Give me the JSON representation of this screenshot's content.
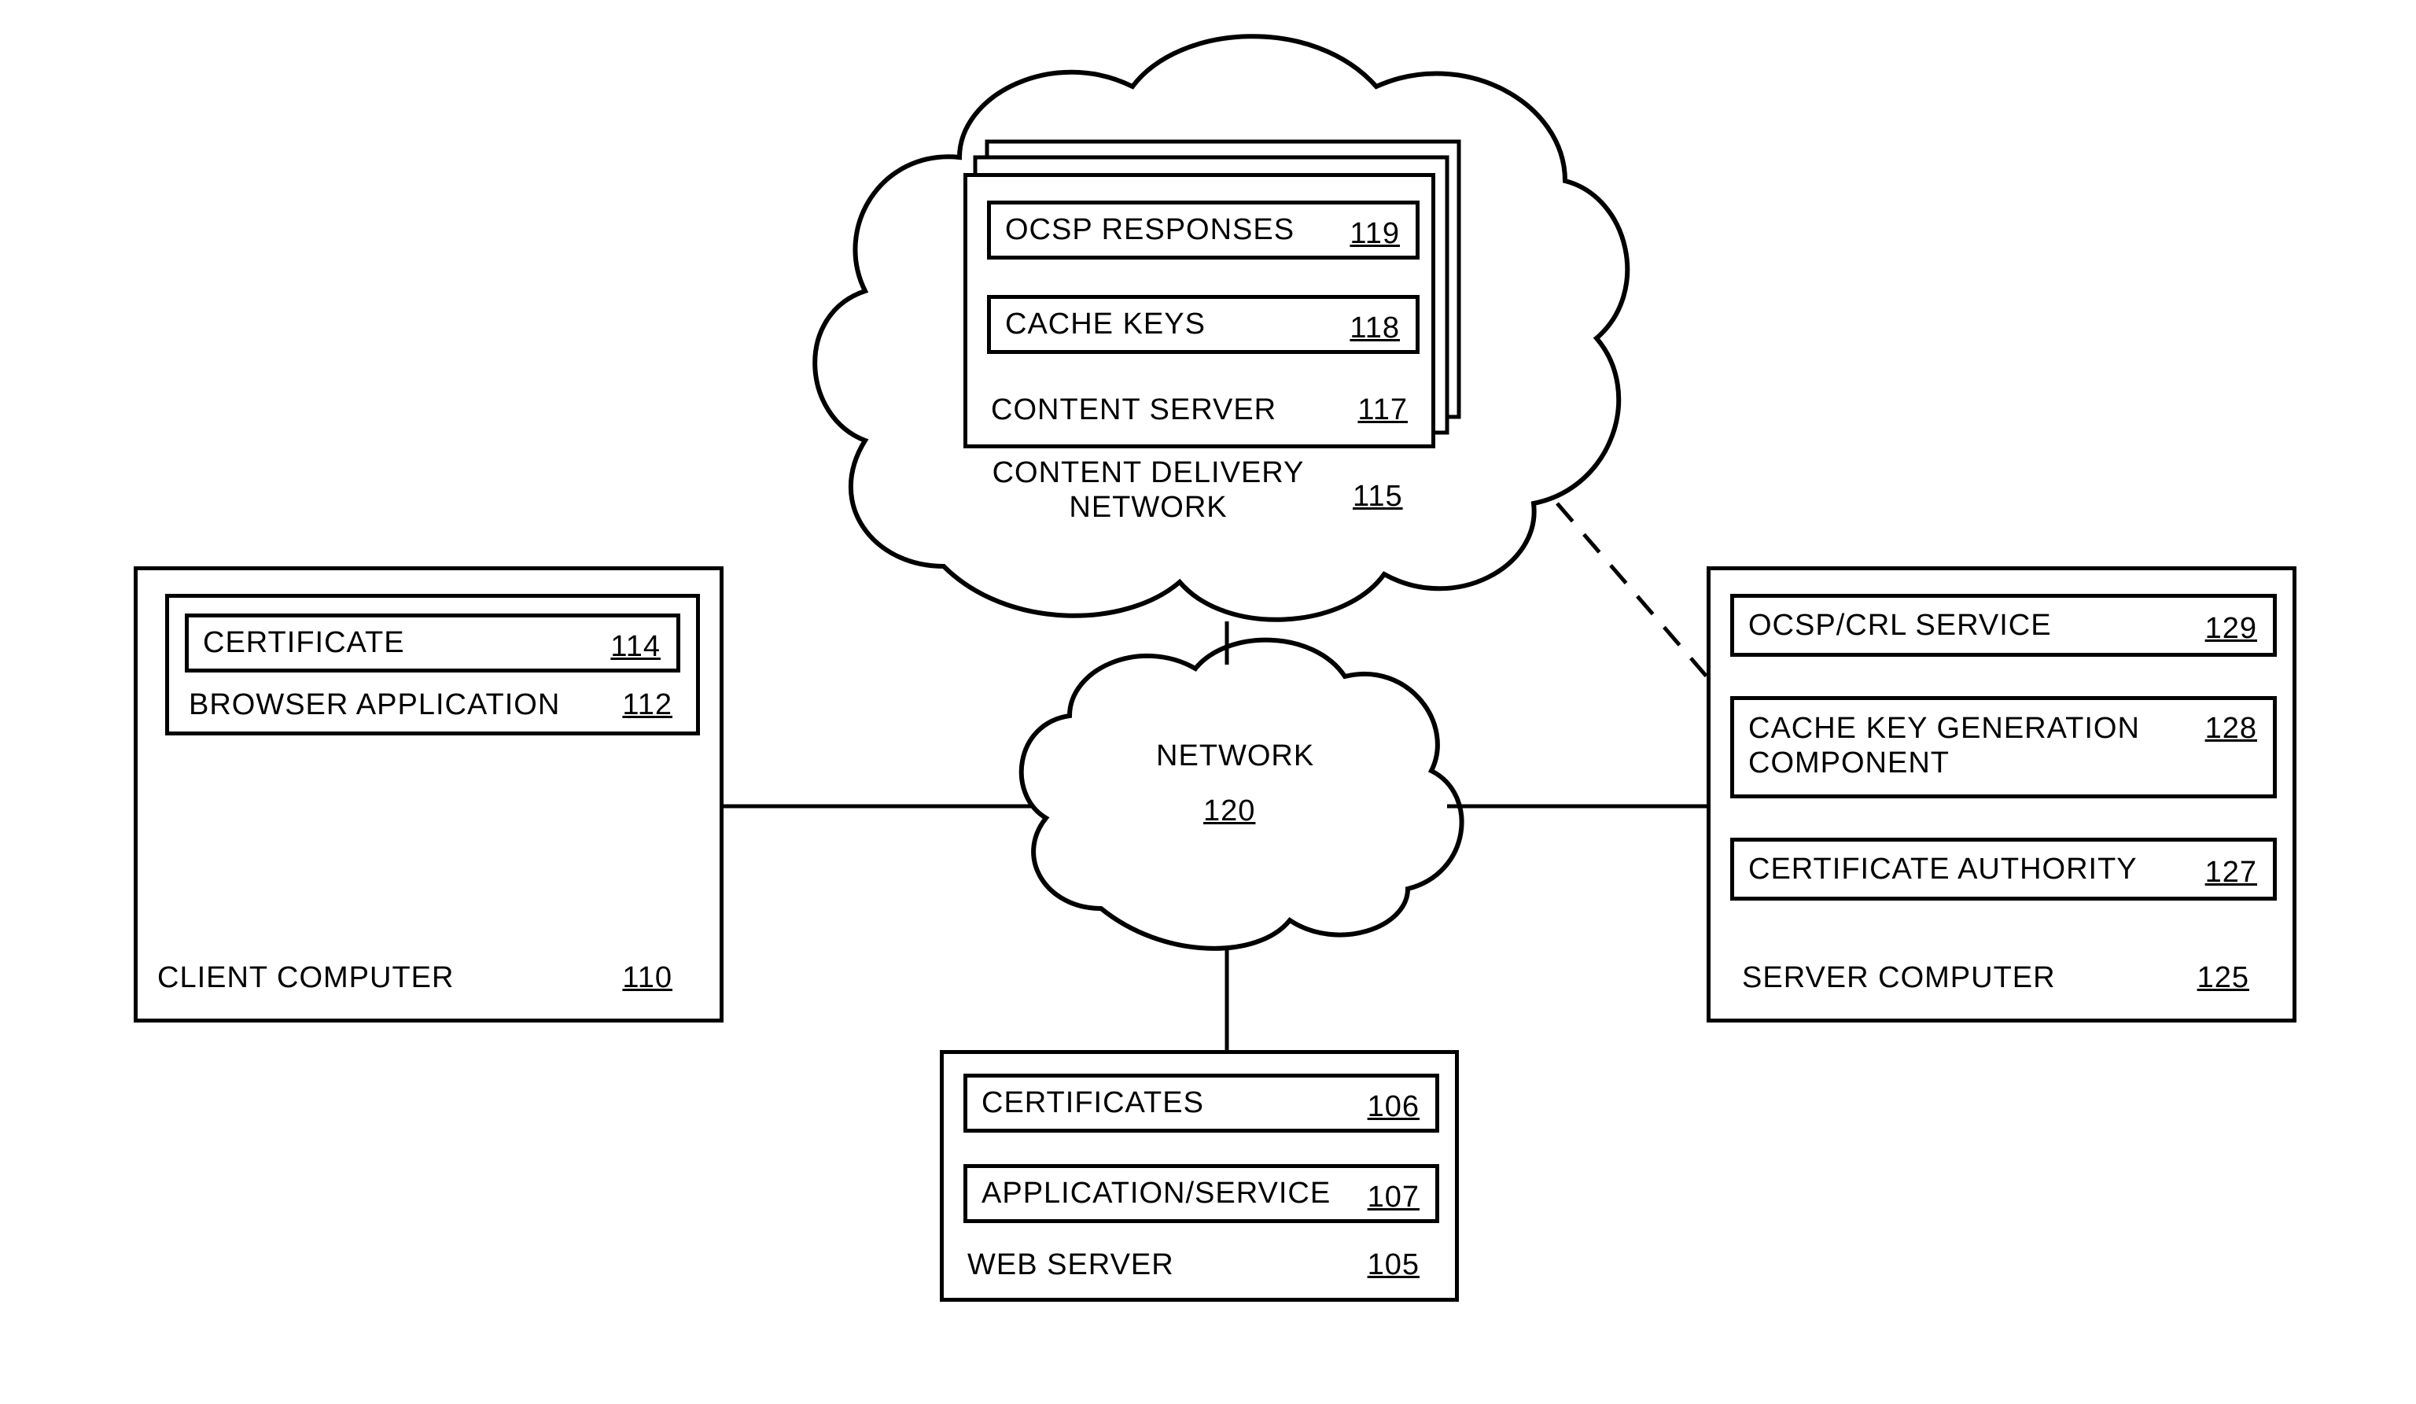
{
  "client": {
    "title": "CLIENT COMPUTER",
    "ref": "110",
    "browser": {
      "label": "BROWSER APPLICATION",
      "ref": "112"
    },
    "certificate": {
      "label": "CERTIFICATE",
      "ref": "114"
    }
  },
  "cdn": {
    "title": "CONTENT DELIVERY NETWORK",
    "ref": "115",
    "content_server": {
      "label": "CONTENT SERVER",
      "ref": "117"
    },
    "cache_keys": {
      "label": "CACHE KEYS",
      "ref": "118"
    },
    "ocsp": {
      "label": "OCSP RESPONSES",
      "ref": "119"
    }
  },
  "network": {
    "title": "NETWORK",
    "ref": "120"
  },
  "webserver": {
    "title": "WEB SERVER",
    "ref": "105",
    "certificates": {
      "label": "CERTIFICATES",
      "ref": "106"
    },
    "app_service": {
      "label": "APPLICATION/SERVICE",
      "ref": "107"
    }
  },
  "server": {
    "title": "SERVER COMPUTER",
    "ref": "125",
    "ocsp_crl": {
      "label": "OCSP/CRL SERVICE",
      "ref": "129"
    },
    "cache_key_gen": {
      "label": "CACHE KEY GENERATION COMPONENT",
      "ref": "128"
    },
    "cert_authority": {
      "label": "CERTIFICATE AUTHORITY",
      "ref": "127"
    }
  }
}
